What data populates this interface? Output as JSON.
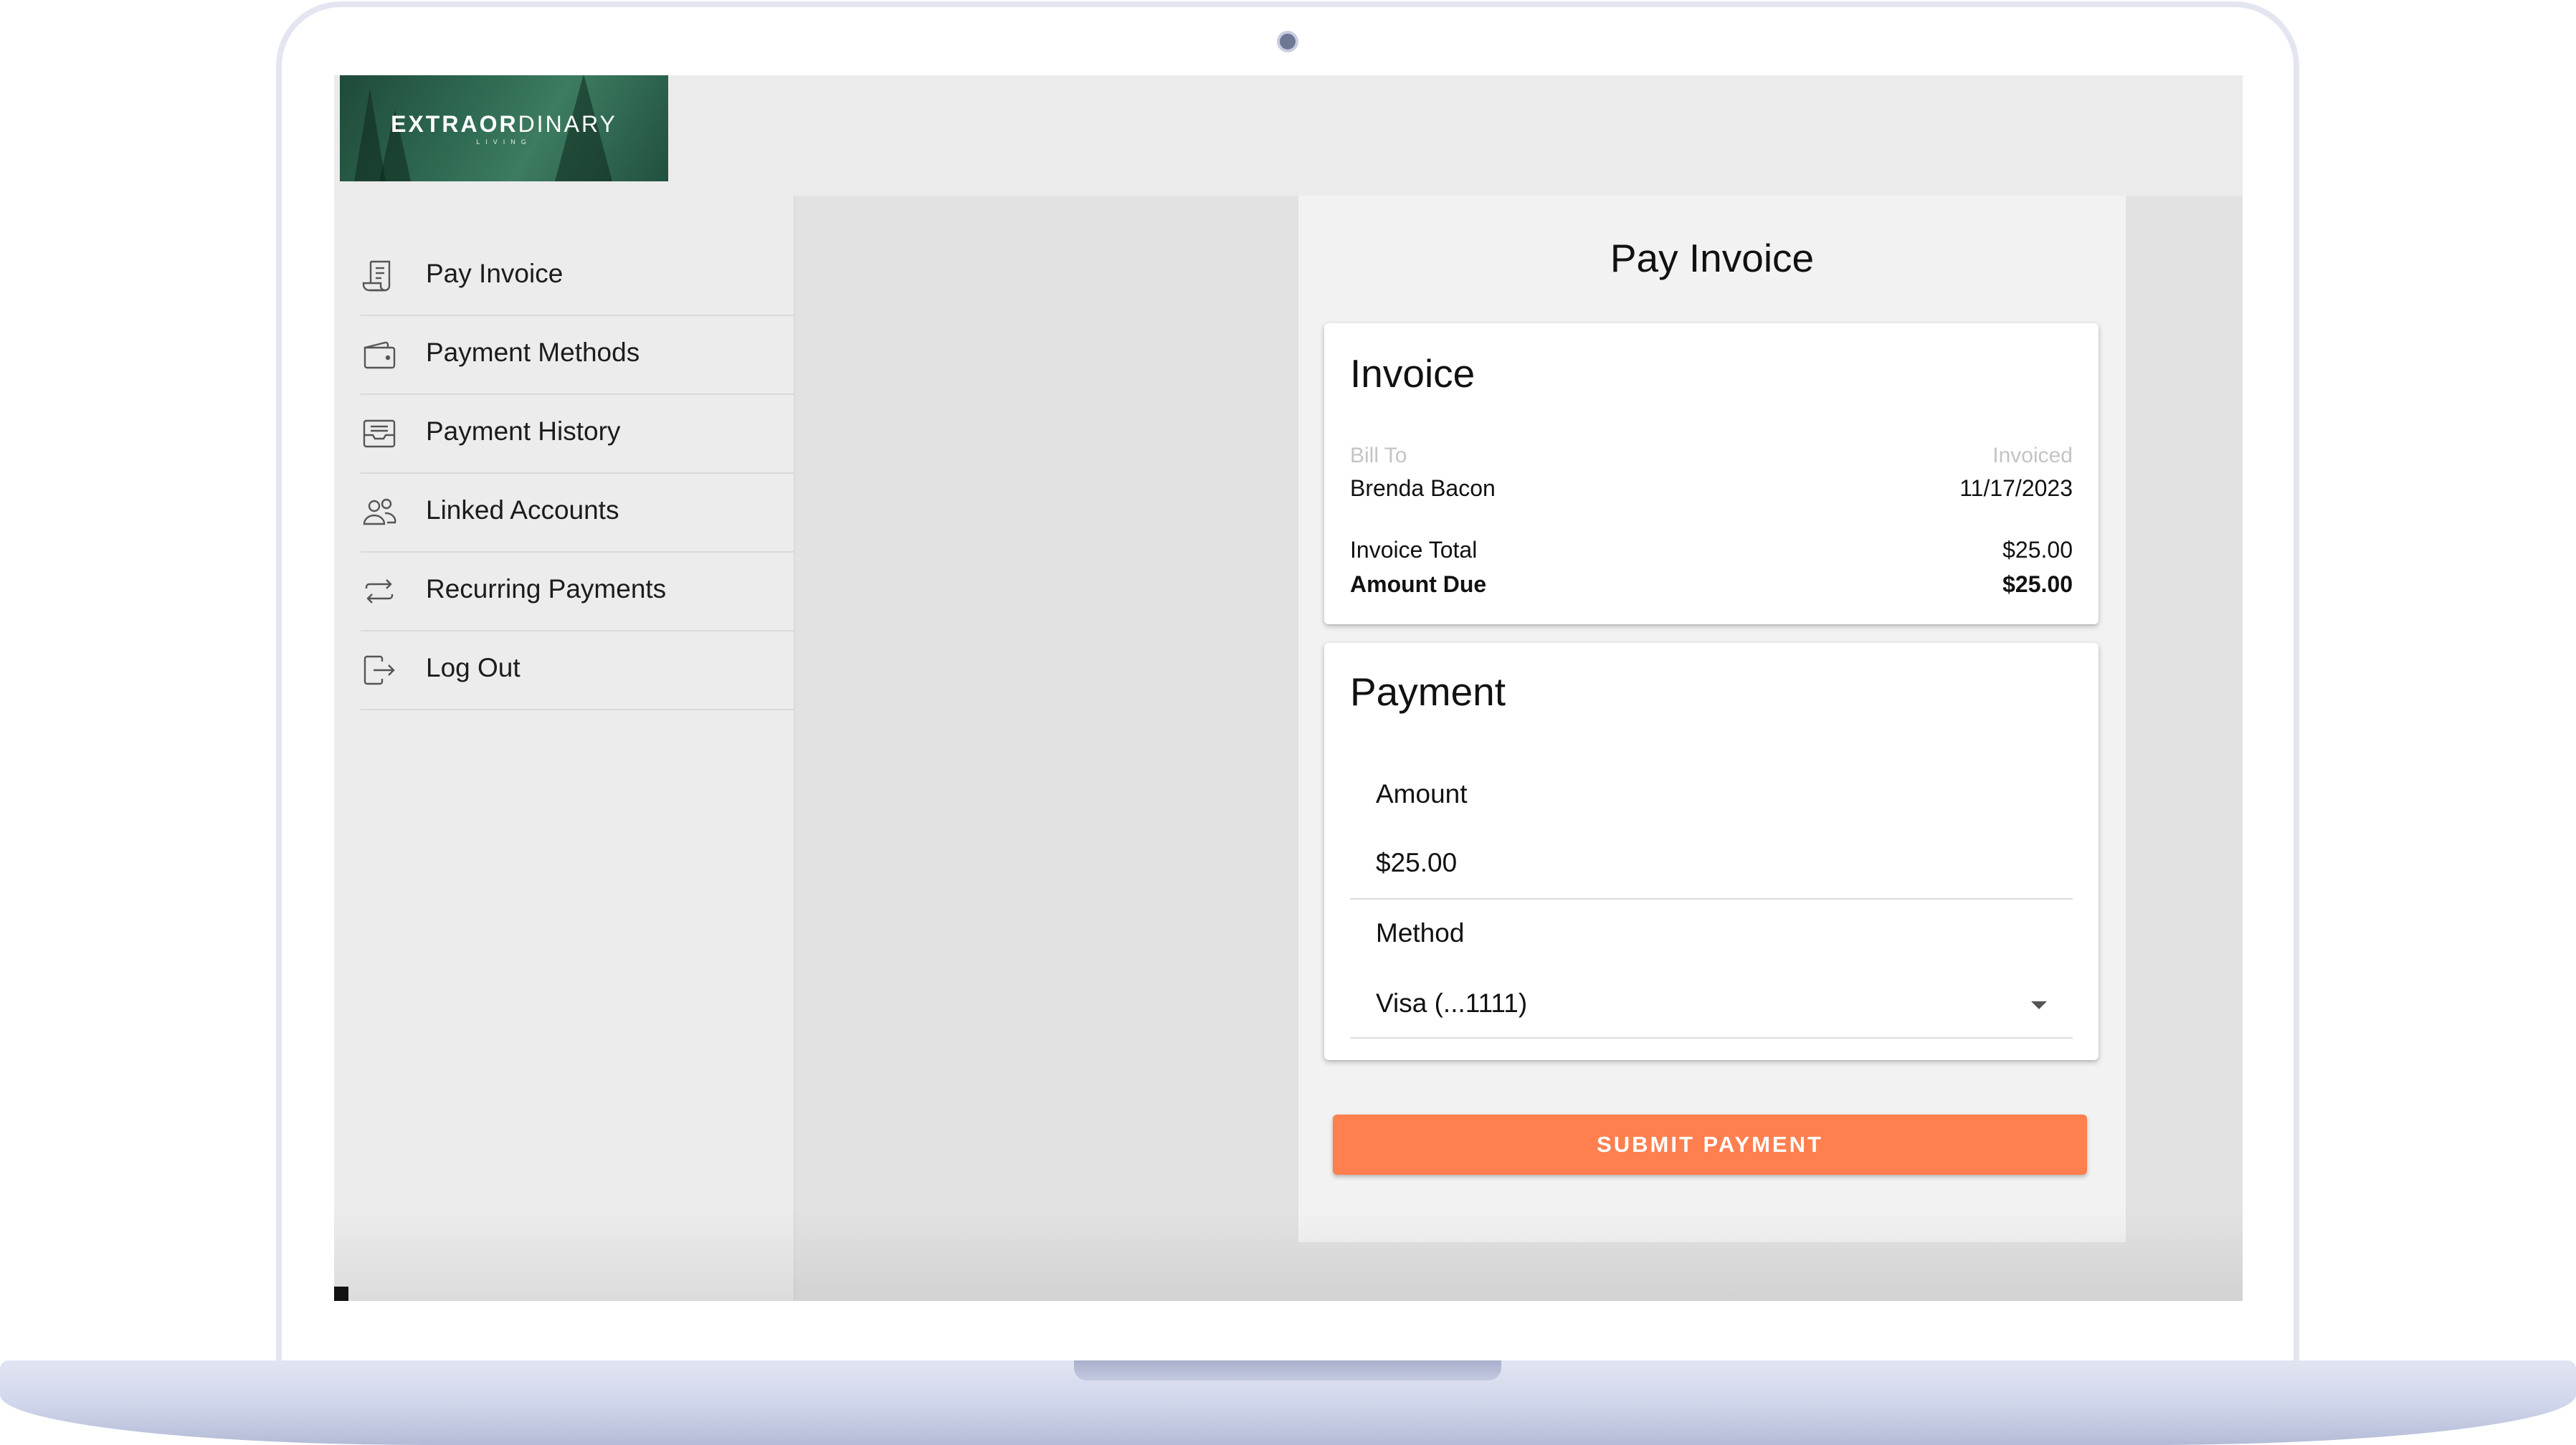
{
  "brand": {
    "logo_main": "EXTRAOR",
    "logo_rest": "DINARY",
    "logo_sub": "LIVING"
  },
  "sidebar": {
    "items": [
      {
        "label": "Pay Invoice",
        "icon": "invoice-icon"
      },
      {
        "label": "Payment Methods",
        "icon": "wallet-icon"
      },
      {
        "label": "Payment History",
        "icon": "inbox-tray-icon"
      },
      {
        "label": "Linked Accounts",
        "icon": "users-icon"
      },
      {
        "label": "Recurring Payments",
        "icon": "repeat-icon"
      },
      {
        "label": "Log Out",
        "icon": "logout-icon"
      }
    ]
  },
  "page": {
    "title": "Pay Invoice"
  },
  "invoice": {
    "title": "Invoice",
    "bill_to_label": "Bill To",
    "bill_to_value": "Brenda Bacon",
    "invoiced_label": "Invoiced",
    "invoiced_value": "11/17/2023",
    "total_label": "Invoice Total",
    "total_value": "$25.00",
    "due_label": "Amount Due",
    "due_value": "$25.00"
  },
  "payment": {
    "title": "Payment",
    "amount_label": "Amount",
    "amount_value": "$25.00",
    "method_label": "Method",
    "method_value": "Visa (...1111)",
    "submit_label": "SUBMIT PAYMENT"
  },
  "colors": {
    "accent": "#ff7f4e",
    "brand_green": "#2f6b52"
  }
}
